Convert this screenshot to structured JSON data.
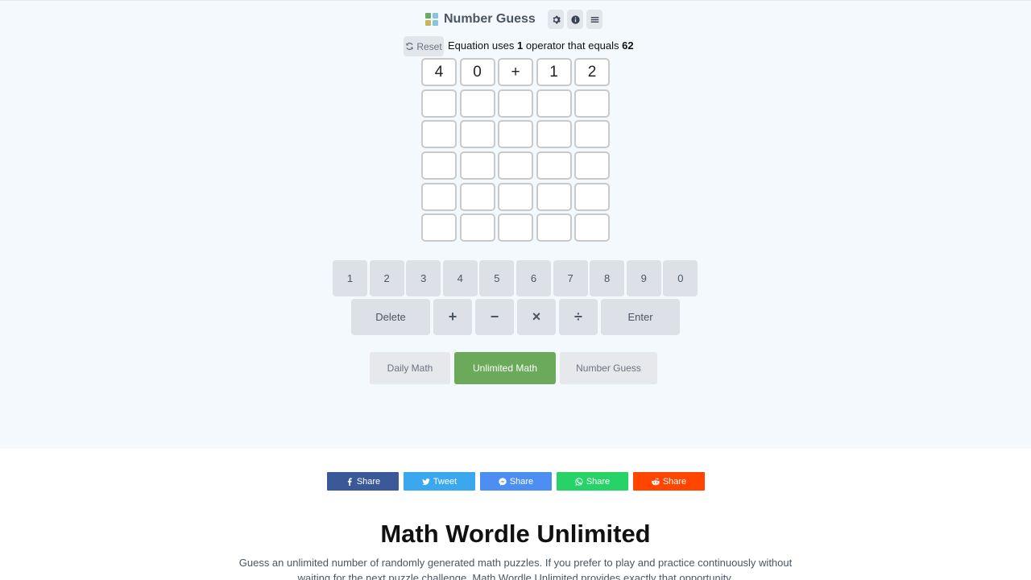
{
  "header": {
    "title": "Number Guess",
    "logo_colors": [
      "#6aaa64",
      "#86c5da",
      "#c9b458",
      "#86c5da"
    ],
    "settings_icon": "gear-icon",
    "info_icon": "info-icon",
    "menu_icon": "menu-icon"
  },
  "toolbar": {
    "reset_label": "Reset",
    "equation_prefix": "Equation uses",
    "operator_count": "1",
    "equation_middle": "operator that equals",
    "target": "62"
  },
  "board": {
    "rows": [
      [
        "4",
        "0",
        "+",
        "1",
        "2"
      ],
      [
        "",
        "",
        "",
        "",
        ""
      ],
      [
        "",
        "",
        "",
        "",
        ""
      ],
      [
        "",
        "",
        "",
        "",
        ""
      ],
      [
        "",
        "",
        "",
        "",
        ""
      ],
      [
        "",
        "",
        "",
        "",
        ""
      ]
    ]
  },
  "keyboard": {
    "digits": [
      "1",
      "2",
      "3",
      "4",
      "5",
      "6",
      "7",
      "8",
      "9",
      "0"
    ],
    "delete_label": "Delete",
    "operators": [
      "+",
      "−",
      "×",
      "÷"
    ],
    "enter_label": "Enter"
  },
  "modes": {
    "daily": "Daily Math",
    "unlimited": "Unlimited Math",
    "number_guess": "Number Guess",
    "active": "unlimited",
    "active_color": "#6aaa5a"
  },
  "share": {
    "facebook": {
      "label": "Share",
      "color": "#3b5998"
    },
    "twitter": {
      "label": "Tweet",
      "color": "#3aa7ef"
    },
    "messenger": {
      "label": "Share",
      "color": "#4c8ef2"
    },
    "whatsapp": {
      "label": "Share",
      "color": "#25d366"
    },
    "reddit": {
      "label": "Share",
      "color": "#ff4500"
    }
  },
  "content": {
    "heading": "Math Wordle Unlimited",
    "description": "Guess an unlimited number of randomly generated math puzzles. If you prefer to play and practice continuously without waiting for the next puzzle challenge, Math Wordle Unlimited provides exactly that opportunity."
  }
}
